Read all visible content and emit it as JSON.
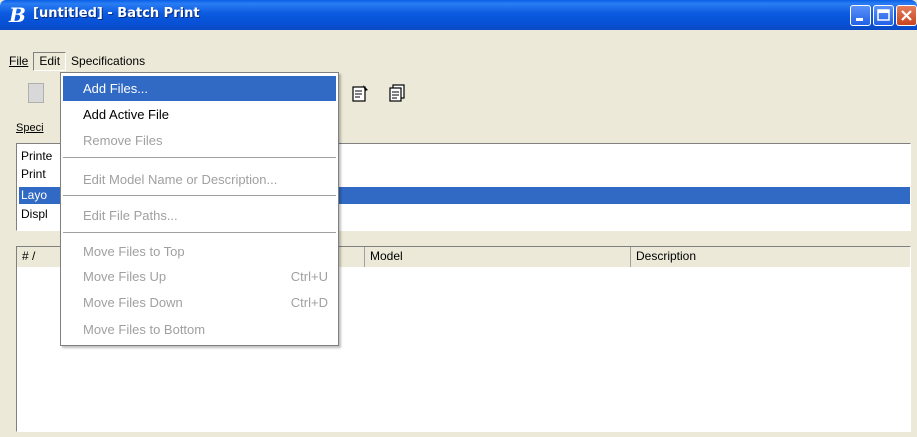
{
  "window": {
    "title": "[untitled] - Batch Print",
    "app_icon": "bentley-b-icon",
    "controls": [
      "minimize-icon",
      "maximize-icon",
      "close-icon"
    ]
  },
  "menubar": {
    "items": [
      "File",
      "Edit",
      "Specifications"
    ],
    "active": "Edit"
  },
  "toolbar": {
    "icons": [
      "new-document-icon",
      "properties-icon",
      "copy-pages-icon"
    ]
  },
  "specifications": {
    "label": "Speci",
    "rows": [
      "Printe",
      "Print",
      "Layo",
      "Displ"
    ],
    "selected_index": 2
  },
  "files_table": {
    "columns": [
      "# /",
      "Model",
      "Description"
    ]
  },
  "edit_menu": {
    "items": [
      {
        "label": "Add Files...",
        "state": "highlighted"
      },
      {
        "label": "Add Active File",
        "state": "enabled"
      },
      {
        "label": "Remove Files",
        "state": "disabled"
      },
      {
        "label": "Edit Model Name or Description...",
        "state": "disabled"
      },
      {
        "label": "Edit File Paths...",
        "state": "disabled"
      },
      {
        "label": "Move Files to Top",
        "state": "disabled"
      },
      {
        "label": "Move Files Up",
        "state": "disabled",
        "shortcut": "Ctrl+U"
      },
      {
        "label": "Move Files Down",
        "state": "disabled",
        "shortcut": "Ctrl+D"
      },
      {
        "label": "Move Files to Bottom",
        "state": "disabled"
      }
    ]
  },
  "colors": {
    "titlebar": "#0a5fe8",
    "selection": "#316ac5",
    "face": "#ece9d8"
  }
}
